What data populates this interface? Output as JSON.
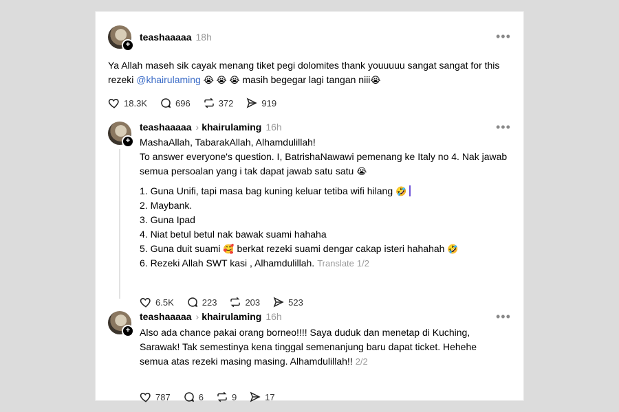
{
  "posts": [
    {
      "username": "teashaaaaa",
      "time": "18h",
      "text_before": "Ya Allah maseh sik cayak menang tiket pegi dolomites thank youuuuu sangat sangat for this rezeki ",
      "mention": "@khairulaming",
      "emoji_a": "😭 😭 😭",
      "text_after": " masih begegar lagi tangan niii",
      "emoji_b": "😭",
      "likes": "18.3K",
      "comments": "696",
      "reposts": "372",
      "shares": "919"
    },
    {
      "username": "teashaaaaa",
      "reply_to": "khairulaming",
      "time": "16h",
      "line1": "MashaAllah, TabarakAllah, Alhamdulillah!",
      "line2": "To answer everyone's question. I, BatrishaNawawi pemenang ke Italy no 4. Nak jawab semua persoalan yang i tak dapat jawab satu satu",
      "line2_emoji": "😭",
      "items": [
        {
          "text": "1. Guna Unifi, tapi masa bag kuning keluar tetiba wifi hilang",
          "emoji": "🤣"
        },
        {
          "text": "2. Maybank.",
          "emoji": ""
        },
        {
          "text": "3. Guna Ipad",
          "emoji": ""
        },
        {
          "text": "4. Niat betul betul nak bawak suami hahaha",
          "emoji": ""
        },
        {
          "text": "5. Guna duit suami",
          "emoji": "🥰",
          "tail": " berkat rezeki suami dengar cakap isteri hahahah",
          "tail_emoji": "🤣"
        },
        {
          "text": "6. Rezeki Allah SWT kasi , Alhamdulillah.",
          "emoji": ""
        }
      ],
      "translate": "Translate",
      "page": "1/2",
      "likes": "6.5K",
      "comments": "223",
      "reposts": "203",
      "shares": "523"
    },
    {
      "username": "teashaaaaa",
      "reply_to": "khairulaming",
      "time": "16h",
      "text": "Also ada chance pakai orang borneo!!!! Saya duduk dan menetap di Kuching, Sarawak! Tak semestinya kena tinggal semenanjung baru dapat ticket. Hehehe semua atas rezeki masing masing. Alhamdulillah!!",
      "page": "2/2",
      "likes": "787",
      "comments": "6",
      "reposts": "9",
      "shares": "17"
    }
  ],
  "more_icon": "•••"
}
